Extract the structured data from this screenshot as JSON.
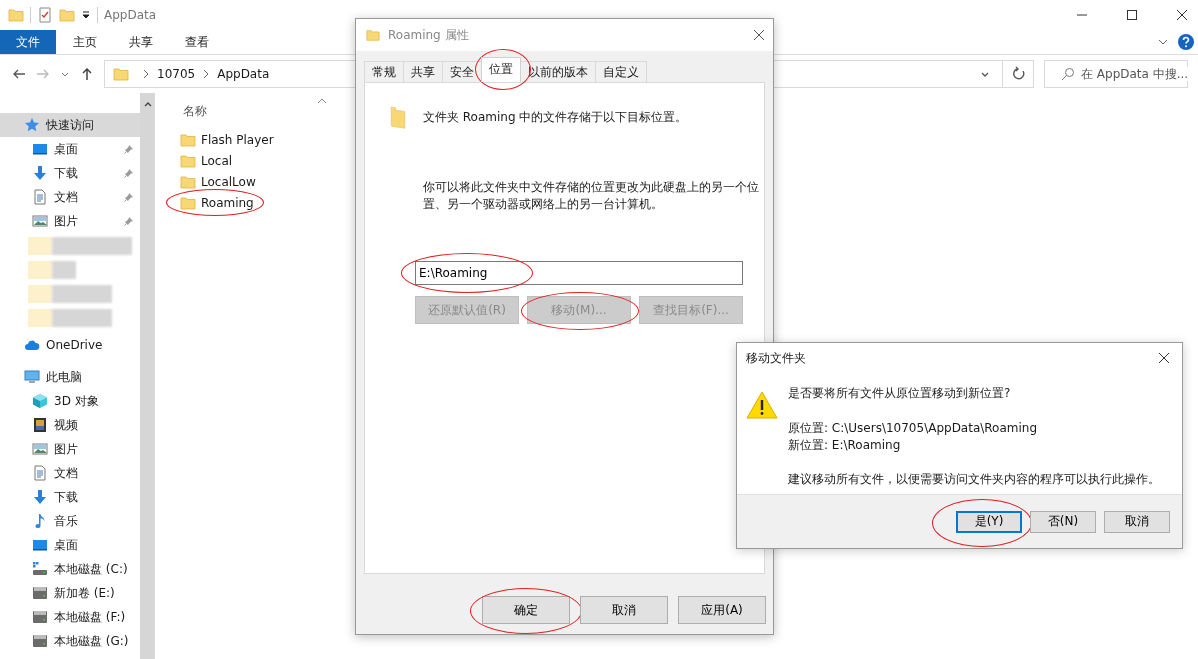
{
  "explorer": {
    "title": "AppData",
    "ribbon_tabs": [
      {
        "label": "文件",
        "primary": true
      },
      {
        "label": "主页",
        "primary": false
      },
      {
        "label": "共享",
        "primary": false
      },
      {
        "label": "查看",
        "primary": false
      }
    ],
    "breadcrumbs": [
      "10705",
      "AppData"
    ],
    "search": {
      "placeholder": "在 AppData 中搜..."
    },
    "sidebar": [
      {
        "label": "快速访问",
        "kind": "star",
        "selected": true,
        "children": [
          {
            "label": "桌面",
            "kind": "desktop",
            "selected": false,
            "pinned": true
          },
          {
            "label": "下载",
            "kind": "download",
            "selected": false,
            "pinned": true
          },
          {
            "label": "文档",
            "kind": "document",
            "selected": false,
            "pinned": true
          },
          {
            "label": "图片",
            "kind": "pictures",
            "selected": false,
            "pinned": true
          }
        ]
      },
      {
        "label": "OneDrive",
        "kind": "cloud",
        "selected": false
      },
      {
        "label": "此电脑",
        "kind": "pc",
        "selected": false,
        "children": [
          {
            "label": "3D 对象",
            "kind": "cube",
            "selected": false
          },
          {
            "label": "视频",
            "kind": "video",
            "selected": false
          },
          {
            "label": "图片",
            "kind": "pictures",
            "selected": false
          },
          {
            "label": "文档",
            "kind": "document",
            "selected": false
          },
          {
            "label": "下载",
            "kind": "download",
            "selected": false
          },
          {
            "label": "音乐",
            "kind": "music",
            "selected": false
          },
          {
            "label": "桌面",
            "kind": "desktop",
            "selected": false
          },
          {
            "label": "本地磁盘 (C:)",
            "kind": "system-drive",
            "selected": false
          },
          {
            "label": "新加卷 (E:)",
            "kind": "drive",
            "selected": false
          },
          {
            "label": "本地磁盘 (F:)",
            "kind": "drive",
            "selected": false
          },
          {
            "label": "本地磁盘 (G:)",
            "kind": "drive",
            "selected": false
          }
        ]
      }
    ],
    "column_header": "名称",
    "files": [
      {
        "name": "Flash Player",
        "circled": false
      },
      {
        "name": "Local",
        "circled": false
      },
      {
        "name": "LocalLow",
        "circled": false
      },
      {
        "name": "Roaming",
        "circled": true
      }
    ]
  },
  "properties": {
    "title": "Roaming 属性",
    "tabs": [
      {
        "label": "常规",
        "selected": false,
        "circled": false
      },
      {
        "label": "共享",
        "selected": false,
        "circled": false
      },
      {
        "label": "安全",
        "selected": false,
        "circled": false
      },
      {
        "label": "位置",
        "selected": true,
        "circled": true
      },
      {
        "label": "以前的版本",
        "selected": false,
        "circled": false
      },
      {
        "label": "自定义",
        "selected": false,
        "circled": false
      }
    ],
    "header_text": "文件夹 Roaming 中的文件存储于以下目标位置。",
    "description": "你可以将此文件夹中文件存储的位置更改为此硬盘上的另一个位置、另一个驱动器或网络上的另一台计算机。",
    "path": {
      "value": "E:\\Roaming",
      "circled": true
    },
    "actions": [
      {
        "label": "还原默认值(R)",
        "disabled": true,
        "circled": false
      },
      {
        "label": "移动(M)...",
        "disabled": true,
        "circled": true
      },
      {
        "label": "查找目标(F)...",
        "disabled": true,
        "circled": false
      }
    ],
    "buttons": [
      {
        "label": "确定",
        "circled": true
      },
      {
        "label": "取消",
        "circled": false
      },
      {
        "label": "应用(A)",
        "circled": false
      }
    ]
  },
  "move_dialog": {
    "title": "移动文件夹",
    "question": "是否要将所有文件从原位置移动到新位置?",
    "details": [
      "原位置: C:\\Users\\10705\\AppData\\Roaming",
      "新位置: E:\\Roaming"
    ],
    "note": "建议移动所有文件，以便需要访问文件夹内容的程序可以执行此操作。",
    "buttons": [
      {
        "label": "是(Y)",
        "focused": true,
        "circled": true
      },
      {
        "label": "否(N)",
        "focused": false,
        "circled": false
      },
      {
        "label": "取消",
        "focused": false,
        "circled": false
      }
    ]
  }
}
